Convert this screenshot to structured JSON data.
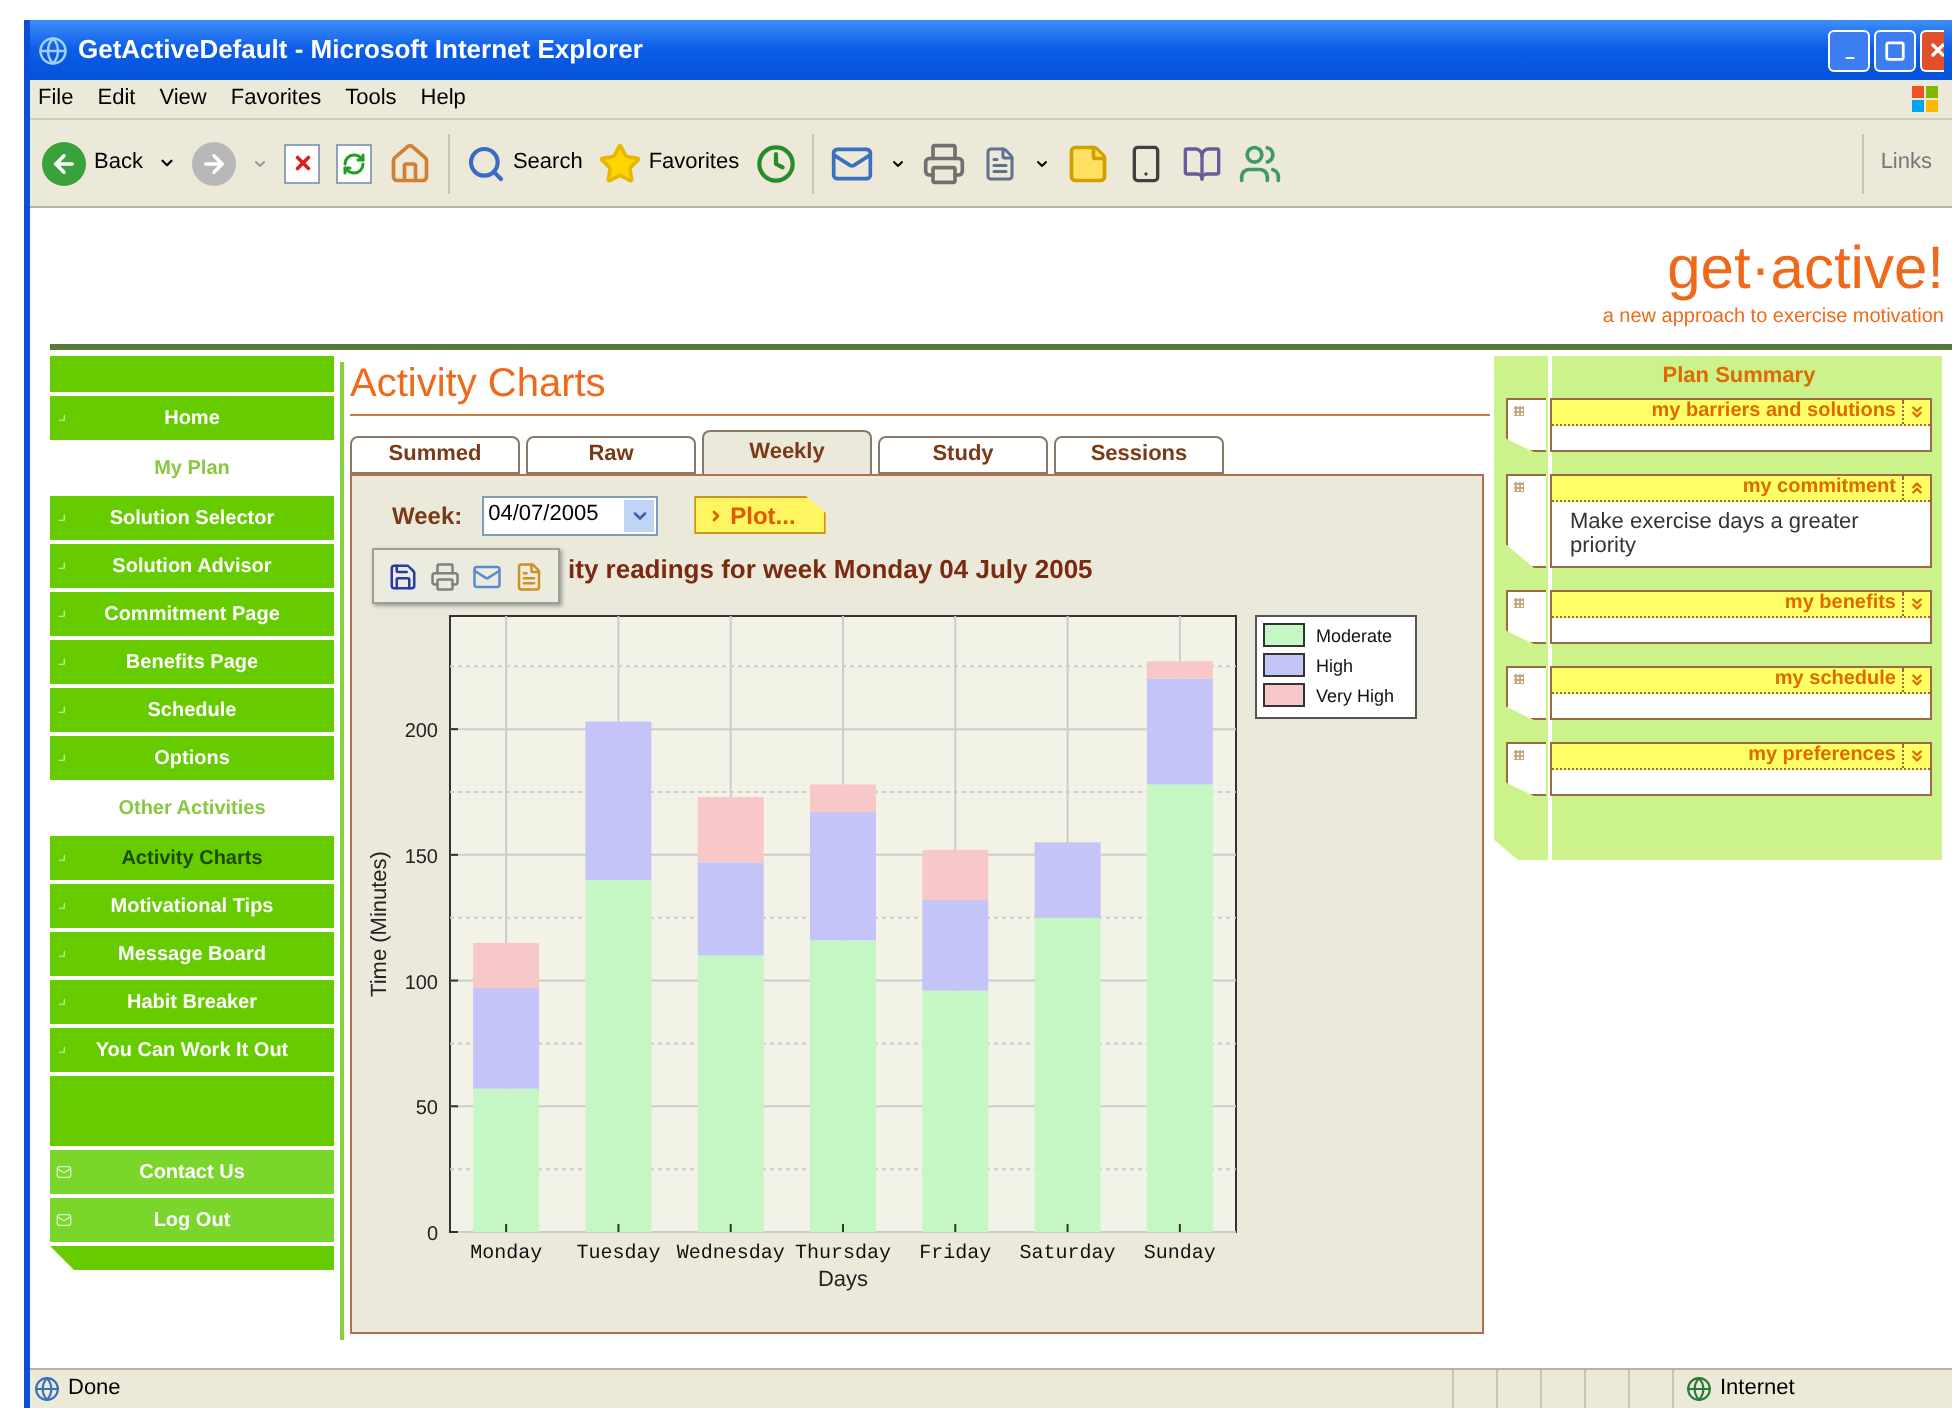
{
  "window": {
    "title": "GetActiveDefault - Microsoft Internet Explorer"
  },
  "menu": [
    "File",
    "Edit",
    "View",
    "Favorites",
    "Tools",
    "Help"
  ],
  "toolbar": {
    "back": "Back",
    "search": "Search",
    "favorites": "Favorites",
    "links": "Links"
  },
  "page": {
    "logo": "get·active!",
    "tagline": "a new approach to exercise motivation",
    "sidebar": [
      {
        "kind": "blank"
      },
      {
        "kind": "link",
        "label": "Home",
        "selected": false
      },
      {
        "kind": "section",
        "label": "My Plan"
      },
      {
        "kind": "link",
        "label": "Solution Selector",
        "selected": false
      },
      {
        "kind": "link",
        "label": "Solution Advisor",
        "selected": false
      },
      {
        "kind": "link",
        "label": "Commitment Page",
        "selected": false
      },
      {
        "kind": "link",
        "label": "Benefits Page",
        "selected": false
      },
      {
        "kind": "link",
        "label": "Schedule",
        "selected": false
      },
      {
        "kind": "link",
        "label": "Options",
        "selected": false
      },
      {
        "kind": "section",
        "label": "Other Activities"
      },
      {
        "kind": "link",
        "label": "Activity Charts",
        "selected": true
      },
      {
        "kind": "link",
        "label": "Motivational Tips",
        "selected": false
      },
      {
        "kind": "link",
        "label": "Message Board",
        "selected": false
      },
      {
        "kind": "link",
        "label": "Habit Breaker",
        "selected": false
      },
      {
        "kind": "link",
        "label": "You Can Work It Out",
        "selected": false
      },
      {
        "kind": "filler"
      },
      {
        "kind": "mail",
        "label": "Contact Us",
        "selected": false
      },
      {
        "kind": "mail",
        "label": "Log Out",
        "selected": false
      }
    ],
    "heading": "Activity Charts",
    "tabs": [
      {
        "label": "Summed",
        "selected": false
      },
      {
        "label": "Raw",
        "selected": false
      },
      {
        "label": "Weekly",
        "selected": true
      },
      {
        "label": "Study",
        "selected": false
      },
      {
        "label": "Sessions",
        "selected": false
      }
    ],
    "week": {
      "label": "Week:",
      "value": "04/07/2005"
    },
    "plot_button": "Plot...",
    "chart_title": "ity readings for week Monday 04 July 2005",
    "chart_data": {
      "type": "bar",
      "stacked": true,
      "xlabel": "Days",
      "ylabel": "Time (Minutes)",
      "categories": [
        "Monday",
        "Tuesday",
        "Wednesday",
        "Thursday",
        "Friday",
        "Saturday",
        "Sunday"
      ],
      "series": [
        {
          "name": "Moderate",
          "color": "#c4f7c4",
          "values": [
            57,
            140,
            110,
            116,
            96,
            125,
            178
          ]
        },
        {
          "name": "High",
          "color": "#c4c4f8",
          "values": [
            40,
            63,
            37,
            51,
            36,
            30,
            42
          ]
        },
        {
          "name": "Very High",
          "color": "#f8c8c8",
          "values": [
            18,
            0,
            26,
            11,
            20,
            null,
            7
          ]
        }
      ],
      "ylim": [
        0,
        245
      ],
      "yticks": [
        0,
        50,
        100,
        150,
        200
      ],
      "grid": true,
      "legend": true
    },
    "plan_summary": {
      "title": "Plan Summary",
      "cards": [
        {
          "title": "my barriers and solutions",
          "expanded": false
        },
        {
          "title": "my commitment",
          "expanded": true,
          "text": "Make exercise days a greater priority"
        },
        {
          "title": "my benefits",
          "expanded": false
        },
        {
          "title": "my schedule",
          "expanded": false
        },
        {
          "title": "my preferences",
          "expanded": false
        }
      ]
    }
  },
  "status_bar": {
    "text": "Done",
    "zone": "Internet"
  }
}
